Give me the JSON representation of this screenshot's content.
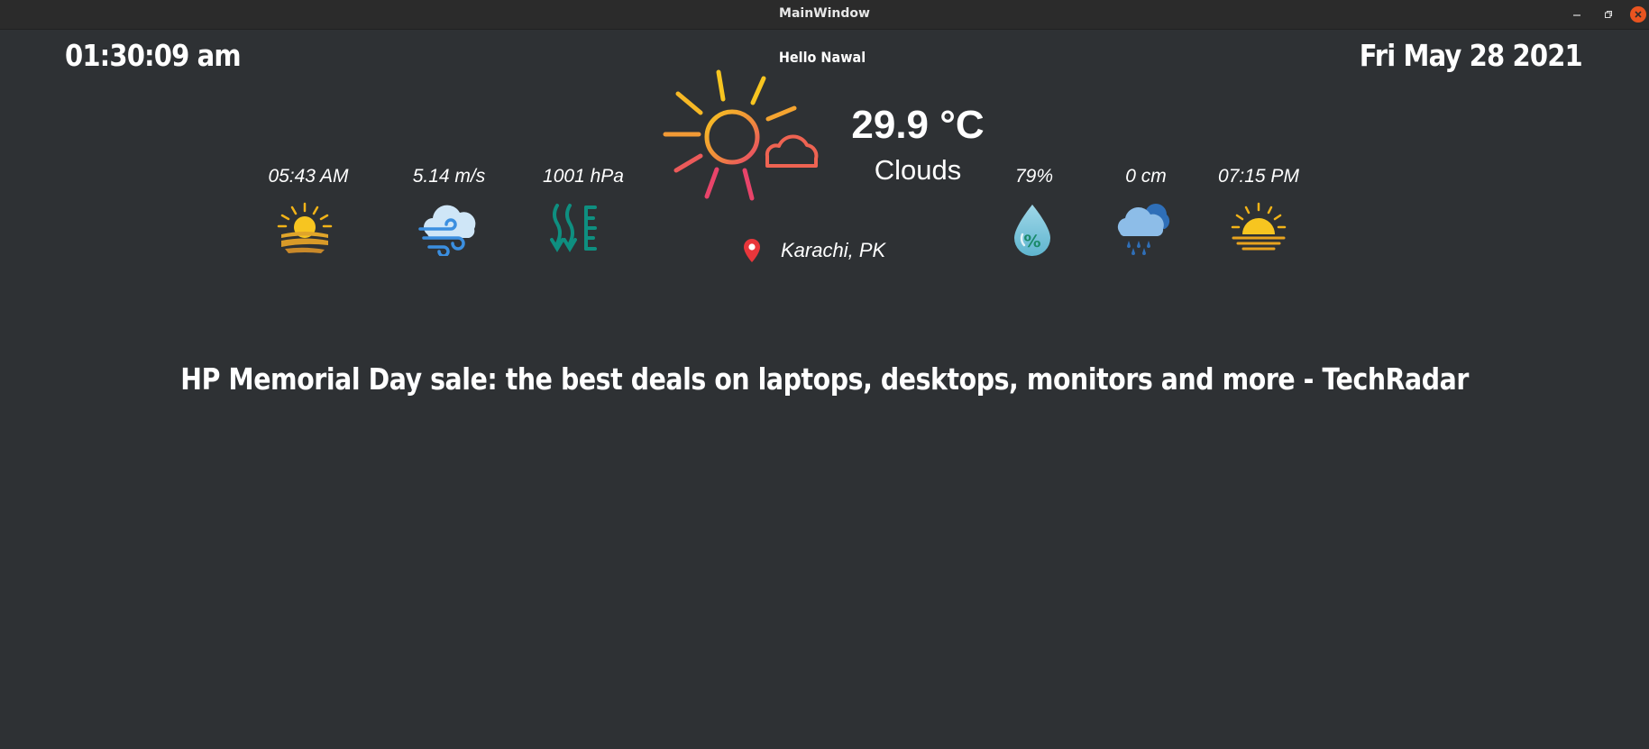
{
  "window": {
    "title": "MainWindow",
    "minimize_icon": "minimize-icon",
    "maximize_icon": "restore-icon",
    "close_icon": "close-icon"
  },
  "header": {
    "time": "01:30:09 am",
    "date": "Fri May 28 2021",
    "greeting": "Hello Nawal"
  },
  "weather": {
    "icon": "sun-cloud-icon",
    "temperature": "29.9 °C",
    "condition": "Clouds",
    "location": "Karachi, PK",
    "location_icon": "location-pin-icon"
  },
  "stats": {
    "sunrise": {
      "value": "05:43 AM",
      "icon": "sunrise-icon"
    },
    "wind": {
      "value": "5.14 m/s",
      "icon": "wind-cloud-icon"
    },
    "pressure": {
      "value": "1001 hPa",
      "icon": "pressure-icon"
    },
    "humidity": {
      "value": "79%",
      "icon": "humidity-drop-icon"
    },
    "rain": {
      "value": "0 cm",
      "icon": "rain-cloud-icon"
    },
    "sunset": {
      "value": "07:15 PM",
      "icon": "sunset-icon"
    }
  },
  "news": {
    "headline": "HP Memorial Day sale: the best deals on laptops, desktops, monitors and more - TechRadar"
  },
  "colors": {
    "background": "#2e3134",
    "titlebar": "#2b2b2b",
    "close_button": "#e95420",
    "sun_yellow": "#f7c520",
    "sun_orange": "#f08a3c",
    "sun_pink": "#e8446a",
    "pressure_teal": "#0e8f80",
    "wind_blue": "#3b8fe0"
  }
}
